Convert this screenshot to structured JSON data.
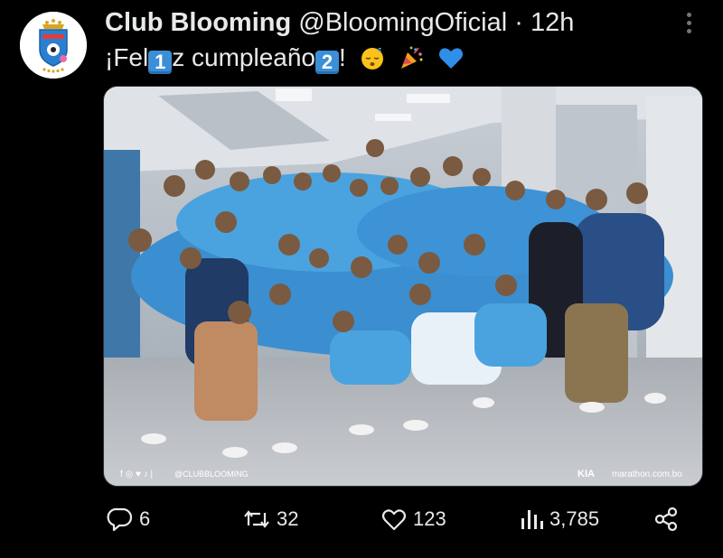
{
  "header": {
    "display_name": "Club Blooming",
    "handle": "@BloomingOficial",
    "separator": "·",
    "time": "12h",
    "more_icon": "more-vertical-icon"
  },
  "tweet": {
    "text_parts": [
      "¡Fel",
      "1",
      "z cumpleaño",
      "2",
      "!"
    ],
    "emojis": [
      "sleeping-face-emoji",
      "party-popper-emoji",
      "blue-heart-emoji"
    ]
  },
  "media": {
    "footer_left": "@CLUBBLOOMING",
    "footer_brand": "KIA",
    "footer_right": "marathon.com.bo",
    "avatar_text": "BLOOMING"
  },
  "actions": {
    "replies": "6",
    "retweets": "32",
    "likes": "123",
    "views": "3,785",
    "icons": [
      "reply-icon",
      "retweet-icon",
      "like-icon",
      "views-icon",
      "share-icon"
    ]
  },
  "colors": {
    "background": "#000000",
    "text": "#e7e9ea",
    "muted": "#71767b",
    "keycap": "#3b8fd6",
    "club_blue": "#4aa3df"
  }
}
